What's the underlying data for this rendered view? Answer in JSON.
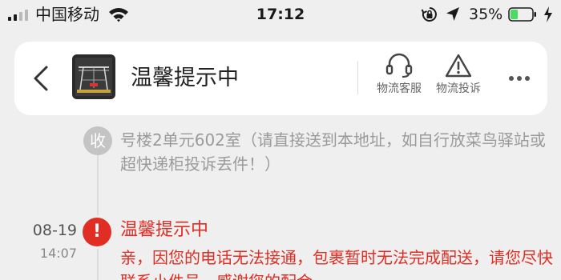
{
  "status_bar": {
    "carrier": "中国移动",
    "time": "17:12",
    "battery_percent": "35%",
    "battery_level": 0.35,
    "icons": [
      "signal-icon",
      "wifi-icon",
      "rotation-lock-icon",
      "location-arrow-icon",
      "battery-icon",
      "charging-bolt-icon"
    ]
  },
  "header": {
    "title": "温馨提示中",
    "actions": [
      {
        "label": "物流客服",
        "icon": "headset-icon"
      },
      {
        "label": "物流投诉",
        "icon": "warning-icon"
      }
    ],
    "more_icon": "more-dots-icon",
    "back_icon": "chevron-left-icon"
  },
  "timeline": {
    "receive_entry": {
      "node_label": "收",
      "address": "号楼2单元602室（请直接送到本地址，如自行放菜鸟驿站或超快递柜投诉丢件！）"
    },
    "alert_entry": {
      "date": "08-19",
      "time": "14:07",
      "node_label": "!",
      "title": "温馨提示中",
      "description": "亲，因您的电话无法接通，包裹暂时无法完成配送，请您尽快联系小件员，感谢您的配合"
    }
  },
  "colors": {
    "accent_red": "#e02e24",
    "muted_gray": "#9a9a9a",
    "background": "#efefef",
    "battery_green": "#4cd964"
  }
}
